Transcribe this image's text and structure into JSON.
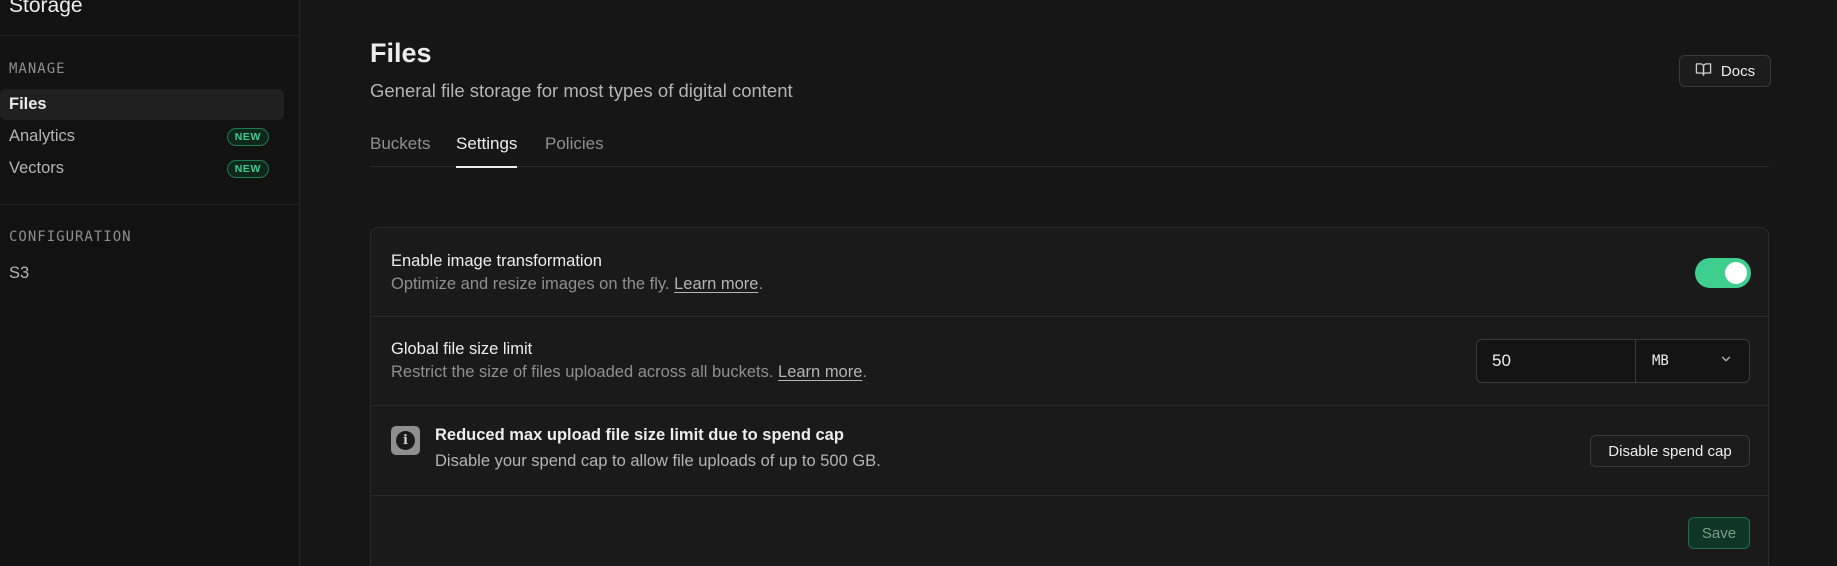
{
  "sidebar": {
    "title": "Storage",
    "sections": [
      {
        "label": "MANAGE",
        "items": [
          {
            "label": "Files",
            "badge": ""
          },
          {
            "label": "Analytics",
            "badge": "NEW"
          },
          {
            "label": "Vectors",
            "badge": "NEW"
          }
        ]
      },
      {
        "label": "CONFIGURATION",
        "items": [
          {
            "label": "S3",
            "badge": ""
          }
        ]
      }
    ],
    "active_item": "Files"
  },
  "header": {
    "title": "Files",
    "subtitle": "General file storage for most types of digital content",
    "docs_label": "Docs",
    "docs_icon": "book-open-icon"
  },
  "tabs": [
    {
      "label": "Buckets"
    },
    {
      "label": "Settings"
    },
    {
      "label": "Policies"
    }
  ],
  "active_tab": "Settings",
  "settings": {
    "image_transformation": {
      "title": "Enable image transformation",
      "description": "Optimize and resize images on the fly.",
      "link": "Learn more",
      "suffix": ".",
      "enabled": true
    },
    "file_size_limit": {
      "title": "Global file size limit",
      "description": "Restrict the size of files uploaded across all buckets.",
      "link": "Learn more",
      "suffix": ".",
      "value": "50",
      "unit": "MB"
    },
    "spend_cap_notice": {
      "icon": "info-icon",
      "title": "Reduced max upload file size limit due to spend cap",
      "description": "Disable your spend cap to allow file uploads of up to 500 GB.",
      "button_label": "Disable spend cap"
    },
    "save_label": "Save"
  },
  "colors": {
    "accent": "#3ecf8e",
    "background": "#161616",
    "sidebar_bg": "#121212",
    "card_bg": "#1a1a1a"
  }
}
